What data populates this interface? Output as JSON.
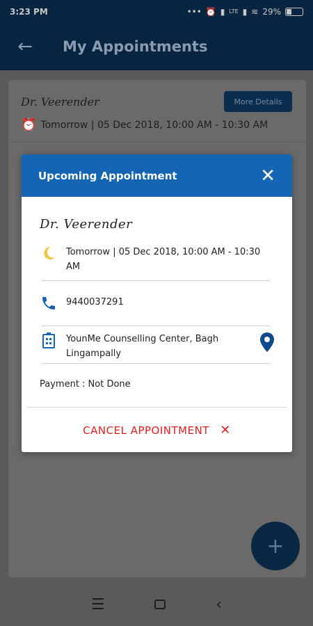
{
  "status_bar": {
    "time": "3:23 PM",
    "icons": [
      "more-icon",
      "alarm-icon",
      "signal-icon",
      "volte-icon",
      "signal-icon",
      "wifi-icon",
      "battery-icon"
    ],
    "battery": "29%"
  },
  "app_bar": {
    "title": "My Appointments",
    "back_icon": "arrow-left-icon"
  },
  "background_card": {
    "doctor": "Dr. Veerender",
    "datetime": "Tomorrow | 05 Dec 2018, 10:00 AM - 10:30 AM",
    "more_details_label": "More Details",
    "icon": "alarm-clock-icon"
  },
  "dialog": {
    "title": "Upcoming Appointment",
    "doctor": "Dr. Veerender",
    "datetime": "Tomorrow | 05 Dec 2018, 10:00 AM - 10:30 AM",
    "phone": "9440037291",
    "address": "YounMe Counselling Center, Bagh Lingampally",
    "payment": "Payment : Not Done",
    "cancel_label": "CANCEL APPOINTMENT",
    "icons": {
      "time": "moon-icon",
      "phone": "phone-icon",
      "address": "building-icon",
      "location": "map-pin-icon",
      "close": "close-icon"
    },
    "colors": {
      "header": "#1565b5",
      "cancel": "#e02020"
    }
  },
  "fab": {
    "icon": "plus-icon"
  },
  "nav_bar": {
    "icons": [
      "recents-icon",
      "home-icon",
      "back-icon"
    ]
  }
}
